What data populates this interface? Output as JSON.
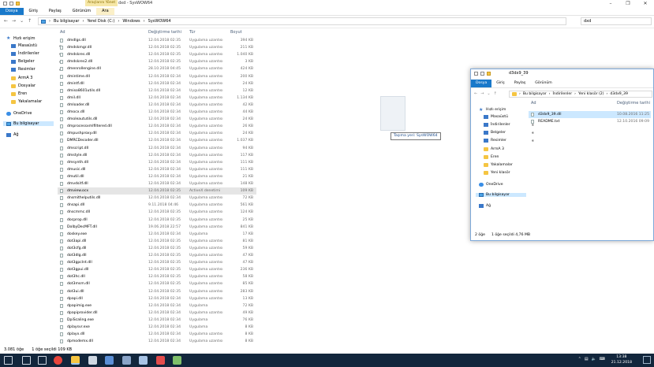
{
  "main": {
    "context_tab": "Araçlarını Yönet",
    "window_title": "dxd - SysWOW64",
    "ribbon_tabs": [
      "Dosya",
      "Giriş",
      "Paylaş",
      "Görünüm",
      "Ara"
    ],
    "breadcrumb": [
      "Bu bilgisayar",
      "Yerel Disk (C:)",
      "Windows",
      "SysWOW64"
    ],
    "search_value": "dxd",
    "columns": {
      "name": "Ad",
      "date": "Değiştirme tarihi",
      "type": "Tür",
      "size": "Boyut"
    },
    "nav": [
      {
        "label": "Hızlı erişim",
        "icon": "star-icon"
      },
      {
        "label": "Masaüstü",
        "icon": "desktop-icon",
        "pinned": true
      },
      {
        "label": "İndirilenler",
        "icon": "download-icon",
        "pinned": true
      },
      {
        "label": "Belgeler",
        "icon": "documents-icon",
        "pinned": true
      },
      {
        "label": "Resimler",
        "icon": "pictures-icon",
        "pinned": true
      },
      {
        "label": "ArmA 3",
        "icon": "folder-icon"
      },
      {
        "label": "Dosyalar",
        "icon": "folder-icon"
      },
      {
        "label": "Eren",
        "icon": "folder-icon"
      },
      {
        "label": "Yakalamalar",
        "icon": "folder-icon"
      },
      {
        "label": "OneDrive",
        "icon": "onedrive-icon"
      },
      {
        "label": "Bu bilgisayar",
        "icon": "computer-icon",
        "selected": true
      },
      {
        "label": "Ağ",
        "icon": "network-icon"
      }
    ],
    "files": [
      {
        "name": "dmdlgs.dll",
        "date": "12.04.2018 02:35",
        "type": "Uygulama uzantısı",
        "size": "394 KB"
      },
      {
        "name": "dmdskmgr.dll",
        "date": "12.04.2018 02:35",
        "type": "Uygulama uzantısı",
        "size": "211 KB"
      },
      {
        "name": "dmdskres.dll",
        "date": "12.04.2018 02:35",
        "type": "Uygulama uzantısı",
        "size": "1.040 KB"
      },
      {
        "name": "dmdskres2.dll",
        "date": "12.04.2018 02:35",
        "type": "Uygulama uzantısı",
        "size": "3 KB"
      },
      {
        "name": "dmenrollengine.dll",
        "date": "28.10.2018 04:45",
        "type": "Uygulama uzantısı",
        "size": "424 KB"
      },
      {
        "name": "dmintime.dll",
        "date": "12.04.2018 02:34",
        "type": "Uygulama uzantısı",
        "size": "200 KB"
      },
      {
        "name": "dmintf.dll",
        "date": "12.04.2018 02:34",
        "type": "Uygulama uzantısı",
        "size": "24 KB"
      },
      {
        "name": "dmiso8601utils.dll",
        "date": "12.04.2018 02:34",
        "type": "Uygulama uzantısı",
        "size": "12 KB"
      },
      {
        "name": "dmil.dll",
        "date": "12.04.2018 02:34",
        "type": "Uygulama uzantısı",
        "size": "1.134 KB"
      },
      {
        "name": "dmloader.dll",
        "date": "12.04.2018 02:34",
        "type": "Uygulama uzantısı",
        "size": "42 KB"
      },
      {
        "name": "dmocx.dll",
        "date": "12.04.2018 02:34",
        "type": "Uygulama uzantısı",
        "size": "44 KB"
      },
      {
        "name": "dmoleaututils.dll",
        "date": "12.04.2018 02:34",
        "type": "Uygulama uzantısı",
        "size": "24 KB"
      },
      {
        "name": "dmprocessxmlfiltered.dll",
        "date": "12.04.2018 02:34",
        "type": "Uygulama uzantısı",
        "size": "26 KB"
      },
      {
        "name": "dmpushproxy.dll",
        "date": "12.04.2018 02:34",
        "type": "Uygulama uzantısı",
        "size": "24 KB"
      },
      {
        "name": "DMRCDecoder.dll",
        "date": "12.04.2018 02:34",
        "type": "Uygulama uzantısı",
        "size": "1.037 KB"
      },
      {
        "name": "dmscript.dll",
        "date": "12.04.2018 02:34",
        "type": "Uygulama uzantısı",
        "size": "94 KB"
      },
      {
        "name": "dmstyle.dll",
        "date": "12.04.2018 02:34",
        "type": "Uygulama uzantısı",
        "size": "117 KB"
      },
      {
        "name": "dmsynth.dll",
        "date": "12.04.2018 02:34",
        "type": "Uygulama uzantısı",
        "size": "111 KB"
      },
      {
        "name": "dmusic.dll",
        "date": "12.04.2018 02:34",
        "type": "Uygulama uzantısı",
        "size": "111 KB"
      },
      {
        "name": "dmutil.dll",
        "date": "12.04.2018 02:34",
        "type": "Uygulama uzantısı",
        "size": "21 KB"
      },
      {
        "name": "dmvdsitf.dll",
        "date": "12.04.2018 02:34",
        "type": "Uygulama uzantısı",
        "size": "148 KB"
      },
      {
        "name": "dmview.ocx",
        "date": "12.04.2018 02:35",
        "type": "ActiveX denetimi",
        "size": "109 KB",
        "selected": true
      },
      {
        "name": "dnsmithelputils.dll",
        "date": "12.04.2018 02:34",
        "type": "Uygulama uzantısı",
        "size": "72 KB"
      },
      {
        "name": "dnsapi.dll",
        "date": "9.11.2018 04:46",
        "type": "Uygulama uzantısı",
        "size": "561 KB"
      },
      {
        "name": "dnscmmc.dll",
        "date": "12.04.2018 02:35",
        "type": "Uygulama uzantısı",
        "size": "124 KB"
      },
      {
        "name": "docprop.dll",
        "date": "12.04.2018 02:35",
        "type": "Uygulama uzantısı",
        "size": "25 KB"
      },
      {
        "name": "DolbyDecMFT.dll",
        "date": "19.06.2018 22:57",
        "type": "Uygulama uzantısı",
        "size": "841 KB"
      },
      {
        "name": "doskey.exe",
        "date": "12.04.2018 02:34",
        "type": "Uygulama",
        "size": "17 KB"
      },
      {
        "name": "dot3api.dll",
        "date": "12.04.2018 02:35",
        "type": "Uygulama uzantısı",
        "size": "81 KB"
      },
      {
        "name": "dot3cfg.dll",
        "date": "12.04.2018 02:35",
        "type": "Uygulama uzantısı",
        "size": "59 KB"
      },
      {
        "name": "dot3dlg.dll",
        "date": "12.04.2018 02:35",
        "type": "Uygulama uzantısı",
        "size": "47 KB"
      },
      {
        "name": "dot3gpclnt.dll",
        "date": "12.04.2018 02:35",
        "type": "Uygulama uzantısı",
        "size": "47 KB"
      },
      {
        "name": "dot3gpui.dll",
        "date": "12.04.2018 02:35",
        "type": "Uygulama uzantısı",
        "size": "236 KB"
      },
      {
        "name": "dot3hc.dll",
        "date": "12.04.2018 02:35",
        "type": "Uygulama uzantısı",
        "size": "58 KB"
      },
      {
        "name": "dot3msm.dll",
        "date": "12.04.2018 02:35",
        "type": "Uygulama uzantısı",
        "size": "85 KB"
      },
      {
        "name": "dot3ui.dll",
        "date": "12.04.2018 02:35",
        "type": "Uygulama uzantısı",
        "size": "283 KB"
      },
      {
        "name": "dpapi.dll",
        "date": "12.04.2018 02:34",
        "type": "Uygulama uzantısı",
        "size": "13 KB"
      },
      {
        "name": "dpapimig.exe",
        "date": "12.04.2018 02:34",
        "type": "Uygulama",
        "size": "72 KB"
      },
      {
        "name": "dpapiprovider.dll",
        "date": "12.04.2018 02:34",
        "type": "Uygulama uzantısı",
        "size": "49 KB"
      },
      {
        "name": "DpiScaling.exe",
        "date": "12.04.2018 02:34",
        "type": "Uygulama",
        "size": "76 KB"
      },
      {
        "name": "dplaysvr.exe",
        "date": "12.04.2018 02:34",
        "type": "Uygulama",
        "size": "8 KB"
      },
      {
        "name": "dplayx.dll",
        "date": "12.04.2018 02:34",
        "type": "Uygulama uzantısı",
        "size": "8 KB"
      },
      {
        "name": "dpmodemx.dll",
        "date": "12.04.2018 02:34",
        "type": "Uygulama uzantısı",
        "size": "8 KB"
      }
    ],
    "status_items": "3.081 öğe",
    "status_selected": "1 öğe seçildi  109 KB",
    "drag_tooltip": "Taşıma yeri: SysWOW64"
  },
  "second": {
    "window_title": "d3dx9_39",
    "ribbon_tabs": [
      "Dosya",
      "Giriş",
      "Paylaş",
      "Görünüm"
    ],
    "breadcrumb": [
      "Bu bilgisayar",
      "İndirilenler",
      "Yeni klasör (2)",
      "d3dx9_39"
    ],
    "columns": {
      "name": "Ad",
      "date": "Değiştirme tarihi"
    },
    "nav": [
      {
        "label": "Hızlı erişim",
        "icon": "star-icon"
      },
      {
        "label": "Masaüstü",
        "icon": "desktop-icon",
        "pinned": true
      },
      {
        "label": "İndirilenler",
        "icon": "download-icon",
        "pinned": true
      },
      {
        "label": "Belgeler",
        "icon": "documents-icon",
        "pinned": true
      },
      {
        "label": "Resimler",
        "icon": "pictures-icon",
        "pinned": true
      },
      {
        "label": "ArmA 3",
        "icon": "folder-icon"
      },
      {
        "label": "Eren",
        "icon": "folder-icon"
      },
      {
        "label": "Yakalamalar",
        "icon": "folder-icon"
      },
      {
        "label": "Yeni klasör",
        "icon": "folder-icon"
      },
      {
        "label": "OneDrive",
        "icon": "onedrive-icon"
      },
      {
        "label": "Bu bilgisayar",
        "icon": "computer-icon",
        "selected": true
      },
      {
        "label": "Ağ",
        "icon": "network-icon"
      }
    ],
    "files": [
      {
        "name": "d3dx9_39.dll",
        "date": "10.08.2016 11:25",
        "selected": true
      },
      {
        "name": "README.txt",
        "date": "12.10.2016 09:09"
      }
    ],
    "status_items": "2 öğe",
    "status_selected": "1 öğe seçildi  4,76 MB"
  },
  "taskbar": {
    "time": "13:38",
    "date": "21.12.2018",
    "apps": [
      "start-icon",
      "search-icon",
      "task-view-icon",
      "chrome-icon",
      "file-explorer-icon",
      "store-icon",
      "app-icon-1",
      "app-icon-2",
      "app-icon-3",
      "app-icon-4",
      "app-icon-5"
    ]
  },
  "colors": {
    "accent": "#1979ca",
    "selection": "#cce8ff",
    "taskbar": "#12263c"
  }
}
